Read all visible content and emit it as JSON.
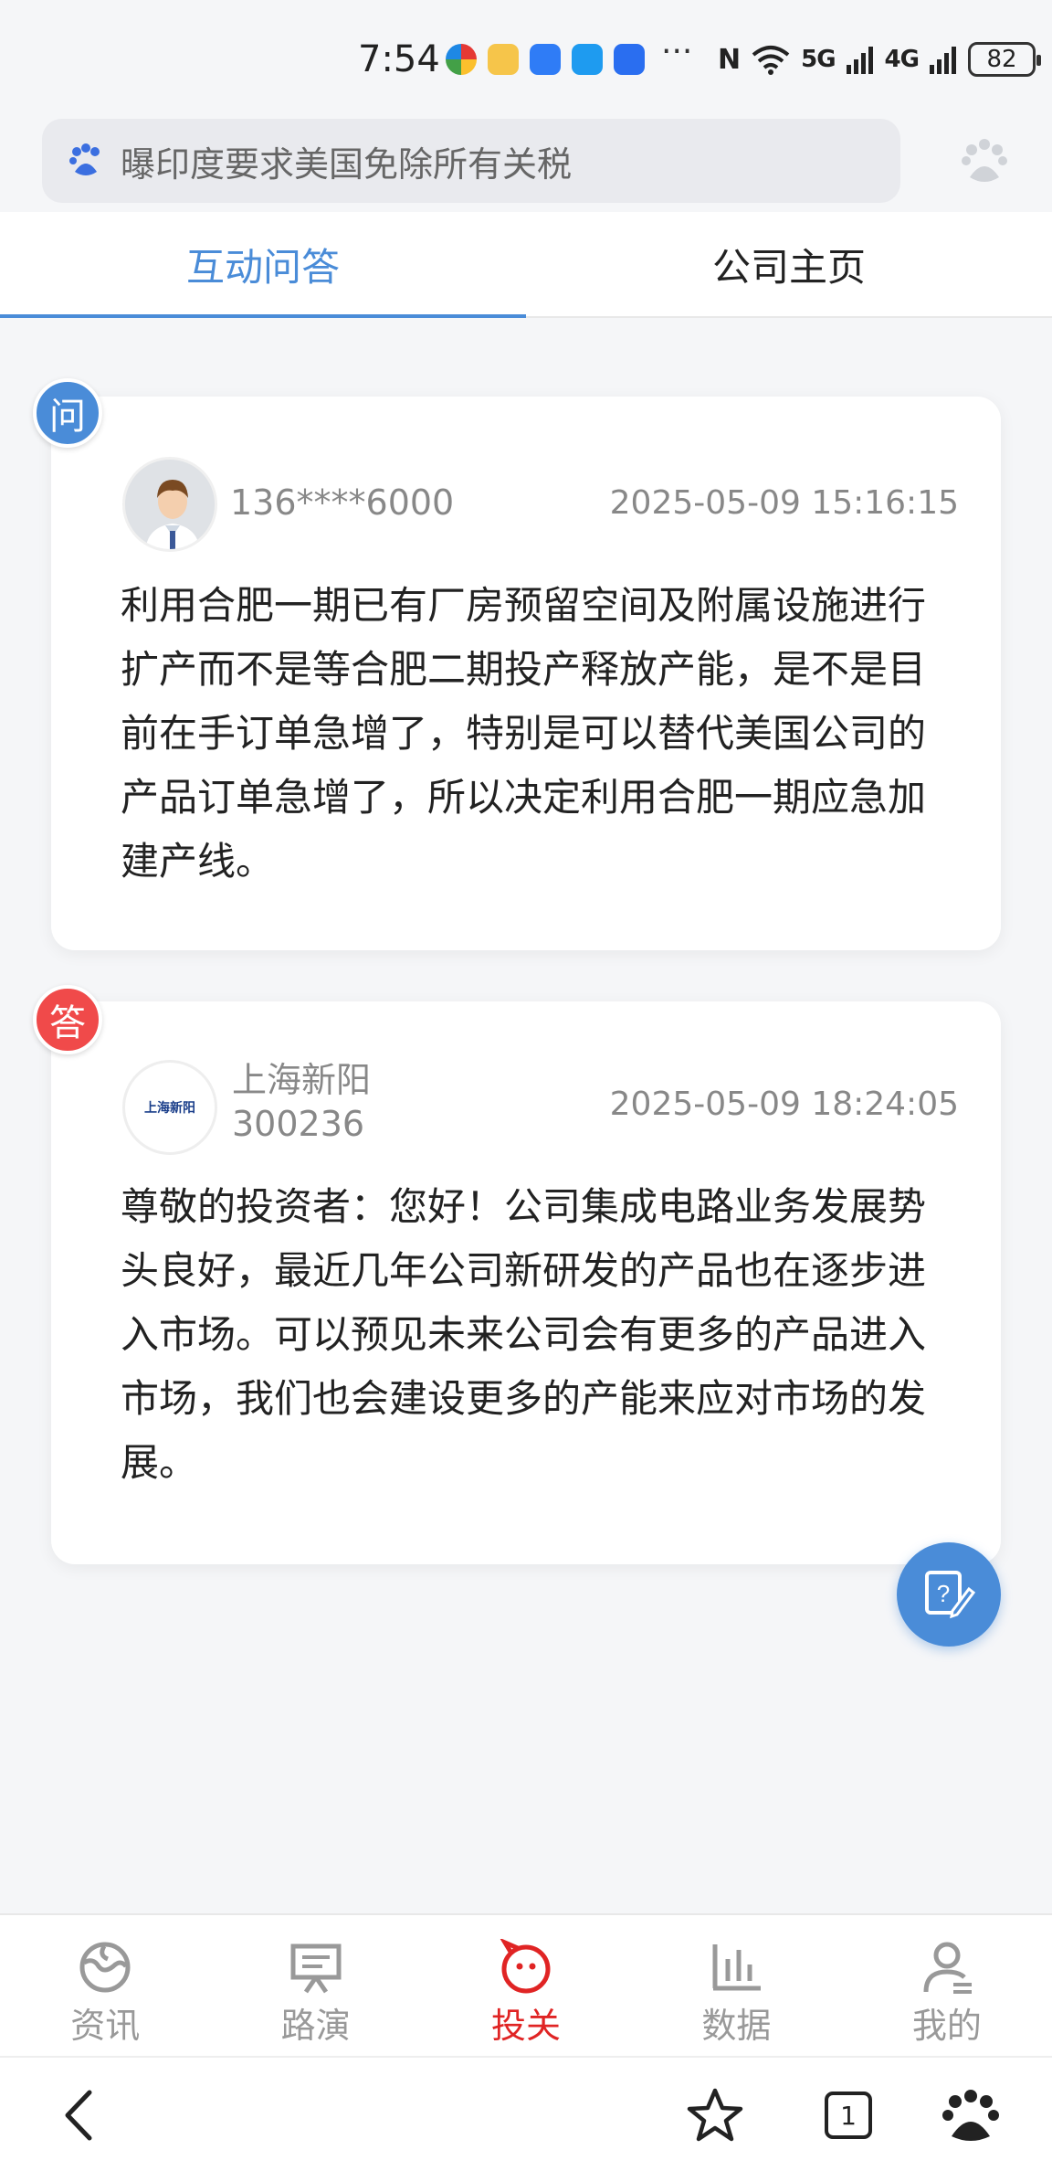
{
  "status_bar": {
    "time": "7:54",
    "more": "···",
    "signal1": "5G",
    "signal2": "4G",
    "battery": "82"
  },
  "search": {
    "text": "曝印度要求美国免除所有关税"
  },
  "tabs": [
    {
      "label": "互动问答",
      "active": true
    },
    {
      "label": "公司主页",
      "active": false
    }
  ],
  "question": {
    "badge": "问",
    "user": "136****6000",
    "date": "2025-05-09 15:16:15",
    "text": "利用合肥一期已有厂房预留空间及附属设施进行扩产而不是等合肥二期投产释放产能，是不是目前在手订单急增了，特别是可以替代美国公司的产品订单急增了，所以决定利用合肥一期应急加建产线。"
  },
  "answer": {
    "badge": "答",
    "company": "上海新阳",
    "code": "300236",
    "logo_text": "上海新阳",
    "date": "2025-05-09 18:24:05",
    "text": "尊敬的投资者：您好！公司集成电路业务发展势头良好，最近几年公司新研发的产品也在逐步进入市场。可以预见未来公司会有更多的产品进入市场，我们也会建设更多的产能来应对市场的发展。"
  },
  "bottom_nav": [
    {
      "label": "资讯",
      "icon": "globe-icon",
      "active": false
    },
    {
      "label": "路演",
      "icon": "presentation-icon",
      "active": false
    },
    {
      "label": "投关",
      "icon": "smile-chat-icon",
      "active": true
    },
    {
      "label": "数据",
      "icon": "bar-chart-icon",
      "active": false
    },
    {
      "label": "我的",
      "icon": "user-icon",
      "active": false
    }
  ],
  "system_bar": {
    "tab_count": "1"
  },
  "colors": {
    "accent": "#4a8cd8",
    "answer_badge": "#f04a4a",
    "active_nav": "#e02424"
  }
}
